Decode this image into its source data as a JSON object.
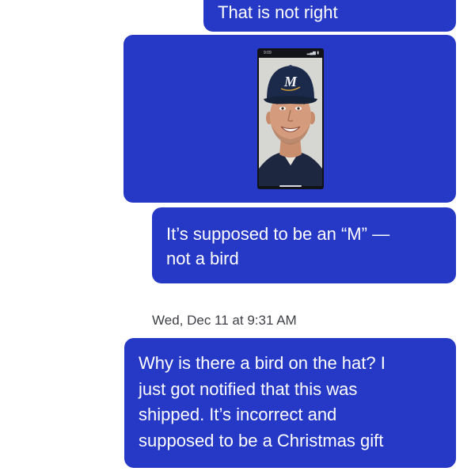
{
  "messages": [
    {
      "type": "text",
      "lines": [
        "That is not right"
      ]
    },
    {
      "type": "image",
      "status_time": "9:09",
      "status_icons": "▂▄▆ ▮"
    },
    {
      "type": "text",
      "lines": [
        "It’s supposed to be an “M” —",
        "not a bird"
      ]
    }
  ],
  "timestamp": "Wed, Dec 11 at 9:31 AM",
  "messages_after": [
    {
      "type": "text",
      "lines": [
        "Why is there a bird on the hat? I",
        "just got notified that this was",
        "shipped. It’s incorrect and",
        "supposed to be a Christmas gift"
      ]
    }
  ],
  "colors": {
    "bubble": "#2638c6",
    "bubble_text": "#ffffff",
    "background": "#ffffff",
    "timestamp": "#3e4046"
  },
  "photo": {
    "cap_logo": "M",
    "cap_color": "#1b2a4a",
    "logo_color": "#f0f2f5"
  }
}
